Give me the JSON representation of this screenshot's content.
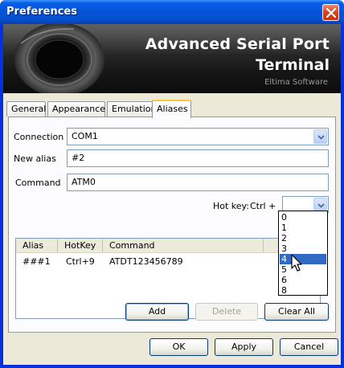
{
  "window": {
    "title": "Preferences",
    "close_icon": "close-icon"
  },
  "banner": {
    "line1": "Advanced Serial Port",
    "line2": "Terminal",
    "vendor": "Eltima Software"
  },
  "tabs": [
    {
      "label": "General",
      "active": false
    },
    {
      "label": "Appearance",
      "active": false
    },
    {
      "label": "Emulation",
      "active": false
    },
    {
      "label": "Aliases",
      "active": true
    }
  ],
  "form": {
    "connection_label": "Connection",
    "connection_value": "COM1",
    "new_alias_label": "New alias",
    "new_alias_value": "#2",
    "command_label": "Command",
    "command_value": "ATM0",
    "hotkey_label": "Hot key:",
    "hotkey_modifier": "Ctrl +",
    "hotkey_value": ""
  },
  "hotkey_options": [
    "0",
    "1",
    "2",
    "3",
    "4",
    "5",
    "6",
    "8"
  ],
  "hotkey_highlighted": "4",
  "aliases_table": {
    "columns": [
      "Alias",
      "HotKey",
      "Command"
    ],
    "rows": [
      {
        "alias": "###1",
        "hotkey": "Ctrl+9",
        "command": "ATDT123456789"
      }
    ]
  },
  "buttons": {
    "add": "Add",
    "delete": "Delete",
    "clear_all": "Clear All",
    "ok": "OK",
    "apply": "Apply",
    "cancel": "Cancel"
  },
  "colors": {
    "titlebar": "#0453d6",
    "selection": "#316ac5",
    "active_tab_accent": "#ffc83c"
  }
}
